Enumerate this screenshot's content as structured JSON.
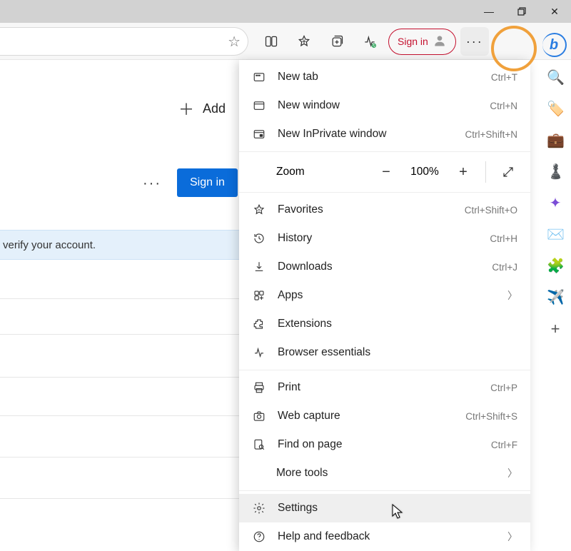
{
  "window": {
    "minimize": "—",
    "maximize": "▢",
    "close": "✕"
  },
  "toolbar": {
    "signin": "Sign in",
    "more": "···"
  },
  "page": {
    "add_shortcut": "Add",
    "signin_btn": "Sign in",
    "verify": "verify your account.",
    "more_dots": "···"
  },
  "menu": {
    "new_tab": {
      "label": "New tab",
      "sc": "Ctrl+T"
    },
    "new_window": {
      "label": "New window",
      "sc": "Ctrl+N"
    },
    "new_inprivate": {
      "label": "New InPrivate window",
      "sc": "Ctrl+Shift+N"
    },
    "zoom": {
      "label": "Zoom",
      "value": "100%"
    },
    "favorites": {
      "label": "Favorites",
      "sc": "Ctrl+Shift+O"
    },
    "history": {
      "label": "History",
      "sc": "Ctrl+H"
    },
    "downloads": {
      "label": "Downloads",
      "sc": "Ctrl+J"
    },
    "apps": {
      "label": "Apps"
    },
    "extensions": {
      "label": "Extensions"
    },
    "essentials": {
      "label": "Browser essentials"
    },
    "print": {
      "label": "Print",
      "sc": "Ctrl+P"
    },
    "capture": {
      "label": "Web capture",
      "sc": "Ctrl+Shift+S"
    },
    "find": {
      "label": "Find on page",
      "sc": "Ctrl+F"
    },
    "more_tools": {
      "label": "More tools"
    },
    "settings": {
      "label": "Settings"
    },
    "help": {
      "label": "Help and feedback"
    }
  },
  "sidebar": {
    "search": "🔍",
    "shop": "🏷️",
    "work": "💼",
    "games": "♟️",
    "office": "✦",
    "outlook": "✉️",
    "puzzle": "🧩",
    "send": "✈️",
    "add": "+"
  },
  "bing": "b"
}
